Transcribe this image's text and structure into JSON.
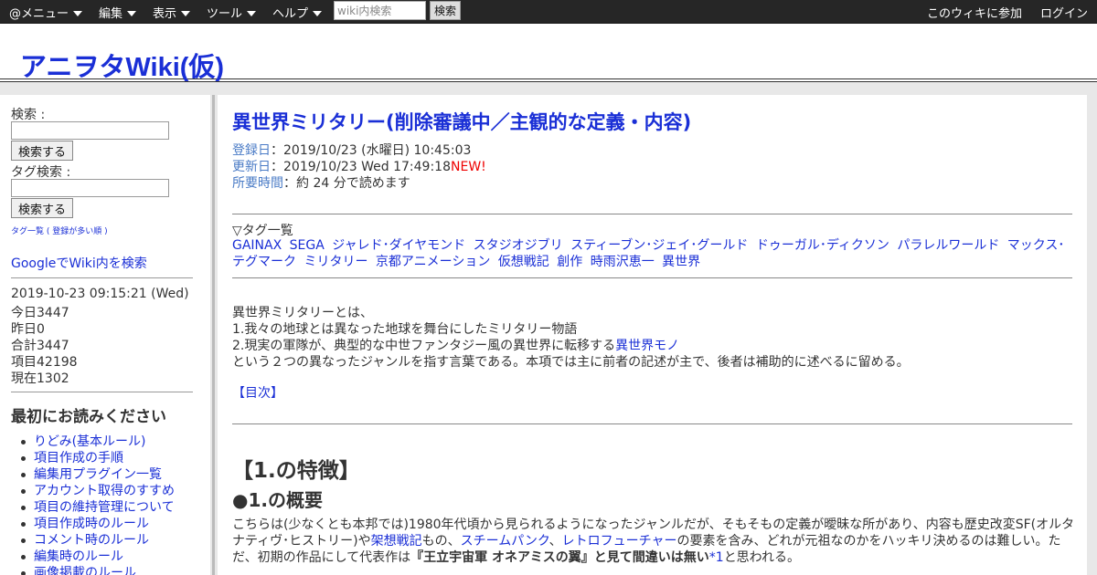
{
  "topbar": {
    "menus": [
      {
        "label": "@メニュー"
      },
      {
        "label": "編集"
      },
      {
        "label": "表示"
      },
      {
        "label": "ツール"
      },
      {
        "label": "ヘルプ"
      }
    ],
    "search_placeholder": "wiki内検索",
    "search_button": "検索",
    "join_link": "このウィキに参加",
    "login_link": "ログイン"
  },
  "site": {
    "title": "アニヲタWiki(仮)"
  },
  "sidebar": {
    "search_label": "検索 :",
    "search_button": "検索する",
    "tag_search_label": "タグ検索 :",
    "tag_search_button": "検索する",
    "taglist_link": "タグ一覧 ( 登録が多い順 )",
    "google_link": "GoogleでWiki内を検索",
    "stats": {
      "datetime": "2019-10-23 09:15:21 (Wed)",
      "today": "今日3447",
      "yesterday": "昨日0",
      "total": "合計3447",
      "items": "項目42198",
      "current": "現在1302"
    },
    "heading": "最初にお読みください",
    "links": [
      "りどみ(基本ルール)",
      "項目作成の手順",
      "編集用プラグイン一覧",
      "アカウント取得のすすめ",
      "項目の維持管理について",
      "項目作成時のルール",
      "コメント時のルール",
      "編集時のルール",
      "画像掲載のルール"
    ]
  },
  "article": {
    "title": "異世界ミリタリー(削除審議中／主観的な定義・内容)",
    "registered_label": "登録日",
    "registered_value": "：2019/10/23 (水曜日) 10:45:03",
    "updated_label": "更新日",
    "updated_value": "：2019/10/23 Wed 17:49:18",
    "updated_new": "NEW!",
    "readtime_label": "所要時間",
    "readtime_value": "：約 24 分で読めます",
    "tags_heading": "▽タグ一覧",
    "tags": [
      "GAINAX",
      "SEGA",
      "ジャレド･ダイヤモンド",
      "スタジオジブリ",
      "スティーブン･ジェイ･グールド",
      "ドゥーガル･ディクソン",
      "パラレルワールド",
      "マックス･テグマーク",
      "ミリタリー",
      "京都アニメーション",
      "仮想戦記",
      "創作",
      "時雨沢恵一",
      "異世界"
    ],
    "intro_1": "異世界ミリタリーとは、",
    "intro_2": "1.我々の地球とは異なった地球を舞台にしたミリタリー物語",
    "intro_3_a": "2.現実の軍隊が、典型的な中世ファンタジー風の異世界に転移する",
    "intro_3_link": "異世界モノ",
    "intro_4": "という２つの異なったジャンルを指す言葉である。本項では主に前者の記述が主で、後者は補助的に述べるに留める。",
    "toc": "【目次】",
    "h2": "【1.の特徴】",
    "h3": "●1.の概要",
    "para_a": "こちらは(少なくとも本邦では)1980年代頃から見られるようになったジャンルだが、そもそもの定義が曖昧な所があり、内容も歴史改変SF(オルタナティヴ･ヒストリー)や",
    "para_link1": "架想戦記",
    "para_b": "もの、",
    "para_link2": "スチームパンク",
    "para_c": "、",
    "para_link3": "レトロフューチャー",
    "para_d": "の要素を含み、どれが元祖なのかをハッキリ決めるのは難しい。ただ、初期の作品にして代表作は",
    "para_bold": "『王立宇宙軍 オネアミスの翼』と見て間違いは無い",
    "para_fn": "*1",
    "para_e": "と思われる。"
  }
}
